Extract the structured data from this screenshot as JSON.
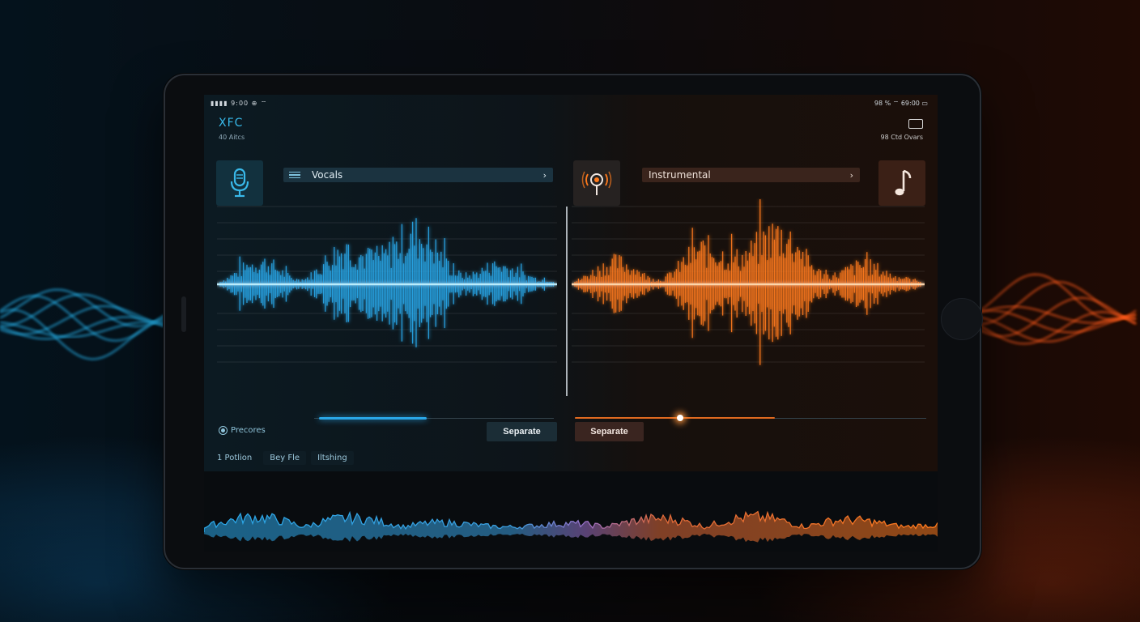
{
  "status_bar": {
    "left": "▮▮▮▮  9:00  ⊕ ⌔",
    "right": "98 % ⌔  69:00 ▭"
  },
  "app": {
    "title": "XFC",
    "subtitle": "40 Aitcs"
  },
  "top_right": {
    "label": "98 Ctd Ovars"
  },
  "tracks": {
    "vocals": {
      "label": "Vocals",
      "color": "#2aa7e8"
    },
    "instrumental": {
      "label": "Instrumental",
      "color": "#ff7a1c"
    }
  },
  "controls": {
    "presets_label": "Precores",
    "separate_left": "Separate",
    "separate_right": "Separate",
    "vocals_slider": 0.45,
    "instrumental_slider": 0.57
  },
  "tabs": [
    {
      "label": "1 Potlion"
    },
    {
      "label": "Bey Fle"
    },
    {
      "label": "Iltshing"
    }
  ],
  "icons": {
    "vocals": "microphone-icon",
    "instrumental": "podcast-mic-icon",
    "note": "music-note-icon",
    "top_right": "battery-icon"
  }
}
